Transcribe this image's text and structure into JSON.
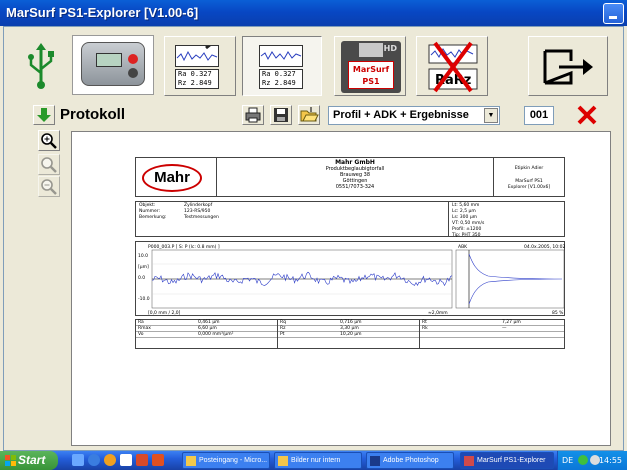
{
  "window": {
    "title": "MarSurf PS1-Explorer [V1.00-6]"
  },
  "toolbar": {
    "device_values": [
      "Ra  0.327",
      "Rz  2.849"
    ],
    "profile_values": [
      "Ra  0.327",
      "Rz  2.849"
    ],
    "disk_label": "MarSurf PS1",
    "disk_hd": "HD",
    "rarz_label": "RaRz"
  },
  "protocol_bar": {
    "title": "Protokoll",
    "selected_format": "Profil + ADK + Ergebnisse",
    "page_number": "001"
  },
  "report": {
    "logo": "Mahr",
    "company": "Mahr GmbH",
    "company_lines": [
      "Produktbeglaubigtorfall",
      "Brauweg 38",
      "Göttingen",
      "0551/7073-324"
    ],
    "right_top": "Etipkin Adier",
    "right_bottom": [
      "MarSurf PS1",
      "Explorer [V1.00x6]"
    ],
    "info_left": [
      [
        "Objekt:",
        "Zylinderkopf"
      ],
      [
        "Nummer:",
        "123-RS/950"
      ],
      [
        "Bemerkung:",
        "Testmessungen"
      ]
    ],
    "info_right": [
      "Lt:      5,60 mm",
      "Lc:      2,5 µm",
      "Ls:      300 µm",
      "VT:      0,50 mm/s",
      "Profil:  ±1200",
      "Tip:     PHT 350"
    ],
    "graph_header_left": "P000_003.P [ S: P (lc: 0.8 mm) ]",
    "graph_header_mid": "ABK",
    "graph_header_right": "04.0x.2005, 10:02",
    "graph_ticks": [
      "10.0",
      "[µm]",
      "0.0",
      "-10.0"
    ],
    "graph_footer_left": "[0,0 mm / 2,0]",
    "graph_footer_mid": "≈2,0mm",
    "graph_footer_right": "85 %",
    "results": [
      [
        [
          "Ra",
          "0,461 µm"
        ],
        [
          "Rq",
          "0,716 µm"
        ],
        [
          "Rt",
          "7,27 µm"
        ]
      ],
      [
        [
          "Rmax",
          "6,60 µm"
        ],
        [
          "Rz",
          "3,30 µm"
        ],
        [
          "Rk",
          "—"
        ]
      ],
      [
        [
          "Vo",
          "0,000 mm³/µm²"
        ],
        [
          "Pt",
          "10,20 µm"
        ],
        [
          "",
          ""
        ]
      ]
    ]
  },
  "taskbar": {
    "start": "Start",
    "tasks": [
      "Posteingang - Micro...",
      "Bilder nur intern",
      "Adobe Photoshop",
      "MarSurf PS1-Explorer"
    ],
    "language": "DE",
    "time": "14:55"
  },
  "colors": {
    "accent_red": "#cc0000",
    "title_blue": "#0a5fd6",
    "green": "#2a9a2a"
  }
}
